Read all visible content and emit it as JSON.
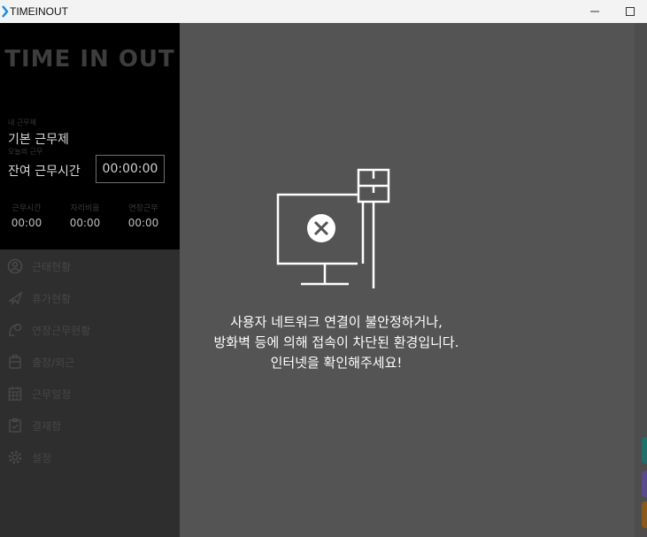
{
  "titlebar": {
    "app_name": "TIMEINOUT",
    "minimize_icon": "minimize-icon",
    "maximize_icon": "maximize-icon"
  },
  "sidebar": {
    "logo": "TIME IN OUT",
    "work_schedule_label": "내 근무제",
    "work_schedule_value": "기본 근무제",
    "today_label": "오늘의 근무",
    "remaining_label": "잔여 근무시간",
    "remaining_time": "00:00:00",
    "stats": [
      {
        "label": "근무시간",
        "value": "00:00"
      },
      {
        "label": "자리비움",
        "value": "00:00"
      },
      {
        "label": "연장근무",
        "value": "00:00"
      }
    ],
    "menu": [
      {
        "label": "근태현황",
        "icon": "user-circle-icon"
      },
      {
        "label": "휴가현황",
        "icon": "airplane-icon"
      },
      {
        "label": "연장근무현황",
        "icon": "overtime-icon"
      },
      {
        "label": "출장/외근",
        "icon": "suitcase-icon"
      },
      {
        "label": "근무일정",
        "icon": "calendar-icon"
      },
      {
        "label": "결재함",
        "icon": "clipboard-icon"
      },
      {
        "label": "설정",
        "icon": "gear-icon"
      }
    ]
  },
  "main": {
    "error_lines": [
      "사용자 네트워크 연결이 불안정하거나,",
      "방화벽 등에 의해 접속이 차단된 환경입니다.",
      "인터넷을 확인해주세요!"
    ]
  },
  "colors": {
    "accent_teal": "#1f6f6a",
    "accent_purple": "#5a4a8c",
    "accent_orange": "#8a5a1a"
  }
}
